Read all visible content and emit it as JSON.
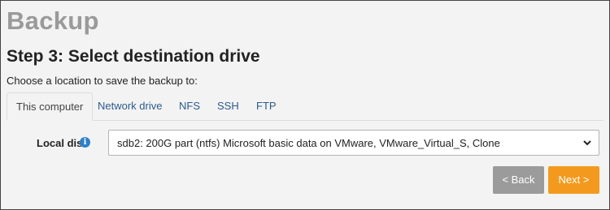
{
  "page": {
    "title": "Backup",
    "step_title": "Step 3: Select destination drive",
    "subtitle": "Choose a location to save the backup to:"
  },
  "tabs": [
    {
      "label": "This computer",
      "active": true
    },
    {
      "label": "Network drive",
      "active": false
    },
    {
      "label": "NFS",
      "active": false
    },
    {
      "label": "SSH",
      "active": false
    },
    {
      "label": "FTP",
      "active": false
    }
  ],
  "local_disk": {
    "label": "Local disk",
    "info_icon": "info-icon",
    "selected": "sdb2: 200G part (ntfs) Microsoft basic data on VMware, VMware_Virtual_S, Clone"
  },
  "buttons": {
    "back_label": "< Back",
    "next_label": "Next >"
  },
  "colors": {
    "next_button": "#f39a1e",
    "back_button": "#9b9b9b",
    "tab_link": "#2c5b8c",
    "info_icon": "#2d80c8"
  }
}
